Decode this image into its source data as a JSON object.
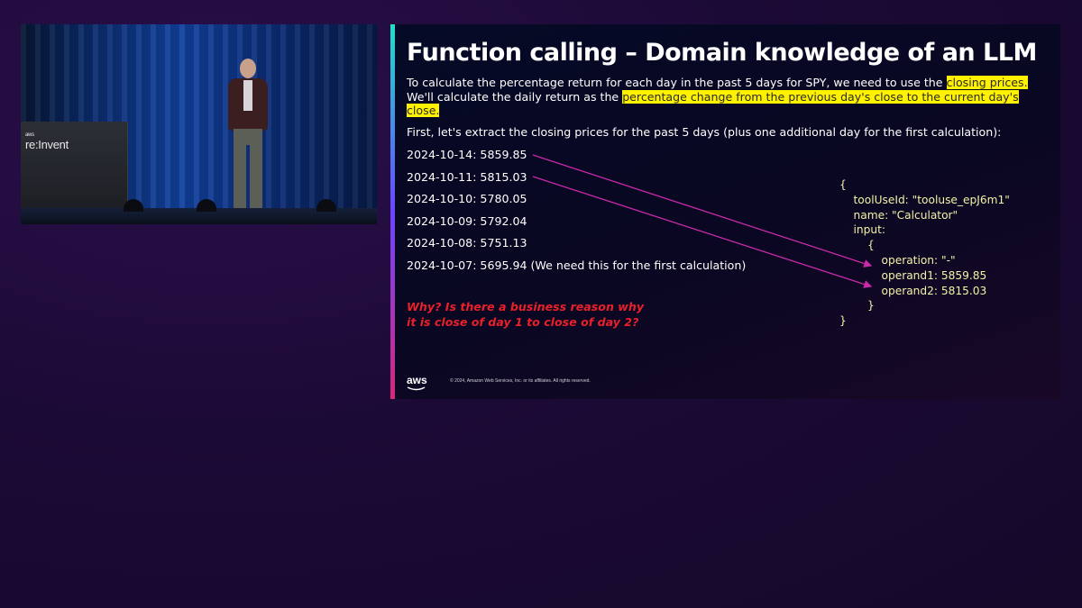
{
  "video": {
    "podium_brand": "aws",
    "podium_event": "re:Invent"
  },
  "slide": {
    "title": "Function calling – Domain knowledge of an LLM",
    "intro": {
      "part1": "To calculate the percentage return for each day in the past 5 days for SPY, we need to use the ",
      "highlight1": "closing prices.",
      "part2": " We'll calculate the daily return as the ",
      "highlight2": "percentage change from the previous day's close to the current day's close."
    },
    "extract_line": "First, let's extract the closing prices for the past 5 days (plus one additional day for the first calculation):",
    "prices": [
      "2024-10-14: 5859.85",
      "2024-10-11: 5815.03",
      "2024-10-10: 5780.05",
      "2024-10-09: 5792.04",
      "2024-10-08: 5751.13",
      "2024-10-07: 5695.94 (We need this for the first calculation)"
    ],
    "question": "Why? Is there a business reason why it is close of day 1 to close of day 2?",
    "code": {
      "open_brace": "{",
      "tool_use_id": "toolUseId: \"tooluse_epJ6m1\"",
      "name": "name: \"Calculator\"",
      "input": "input:",
      "inner_open": "{",
      "operation": "operation: \"-\"",
      "operand1": "operand1: 5859.85",
      "operand2": "operand2: 5815.03",
      "inner_close": "}",
      "close_brace": "}"
    },
    "footer": {
      "logo": "aws",
      "copyright": "© 2024, Amazon Web Services, Inc. or its affiliates. All rights reserved."
    },
    "colors": {
      "highlight": "#fff200",
      "question": "#e8202a",
      "code": "#f2f2a8",
      "arrow": "#c82aa8"
    }
  }
}
